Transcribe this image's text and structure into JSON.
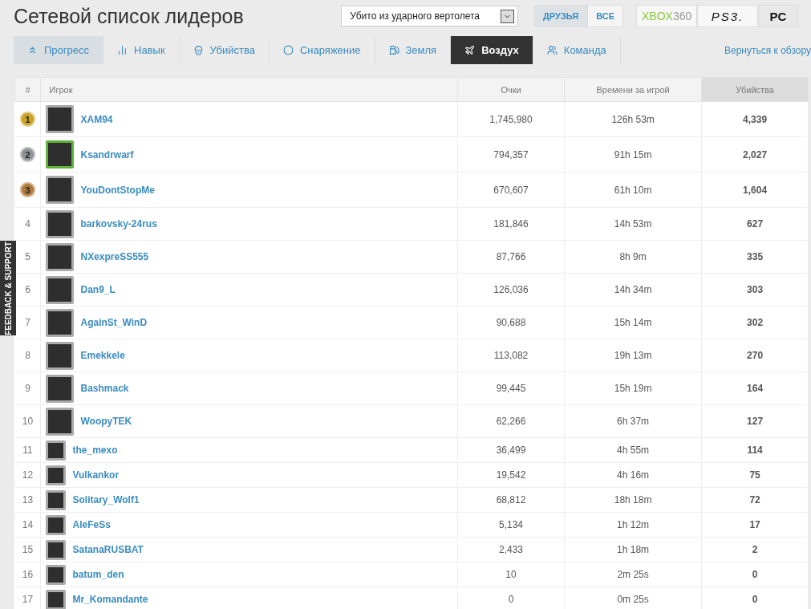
{
  "title": "Сетевой список лидеров",
  "filter_dropdown": {
    "value": "Убито из ударного вертолета"
  },
  "scope_toggle": [
    {
      "label": "ДРУЗЬЯ",
      "selected": true
    },
    {
      "label": "ВСЕ",
      "selected": false
    }
  ],
  "platforms": [
    {
      "label": "XBOX",
      "suffix": "360",
      "kind": "xbox",
      "selected": false
    },
    {
      "label": "PS3.",
      "kind": "ps",
      "selected": false
    },
    {
      "label": "PC",
      "kind": "pc",
      "selected": true
    }
  ],
  "tabs": [
    {
      "label": "Прогресс",
      "selected": false,
      "hovered": true
    },
    {
      "label": "Навык",
      "selected": false,
      "hovered": false
    },
    {
      "label": "Убийства",
      "selected": false,
      "hovered": false
    },
    {
      "label": "Снаряжение",
      "selected": false,
      "hovered": false
    },
    {
      "label": "Земля",
      "selected": false,
      "hovered": false
    },
    {
      "label": "Воздух",
      "selected": true,
      "hovered": false
    },
    {
      "label": "Команда",
      "selected": false,
      "hovered": false
    }
  ],
  "back_link": "Вернуться к обзору",
  "feedback_tab": "FEEDBACK & SUPPORT",
  "table": {
    "columns": [
      {
        "label": "#",
        "sorted": false
      },
      {
        "label": "Игрок",
        "sorted": false
      },
      {
        "label": "Очки",
        "sorted": false
      },
      {
        "label": "Времени за игрой",
        "sorted": false
      },
      {
        "label": "Убийства",
        "sorted": true
      }
    ],
    "rows": [
      {
        "rank": "1",
        "medal": true,
        "color": "#c9a227",
        "kind": "large",
        "highlighted": false,
        "player": "XAM94",
        "score": "1,745,980",
        "time": "126h 53m",
        "kills": "4,339"
      },
      {
        "rank": "2",
        "medal": true,
        "color": "#8f9398",
        "kind": "large",
        "highlighted": true,
        "player": "Ksandrwarf",
        "score": "794,357",
        "time": "91h 15m",
        "kills": "2,027"
      },
      {
        "rank": "3",
        "medal": true,
        "color": "#b07a3e",
        "kind": "large",
        "highlighted": false,
        "player": "YouDontStopMe",
        "score": "670,607",
        "time": "61h 10m",
        "kills": "1,604"
      },
      {
        "rank": "4",
        "medal": false,
        "kind": "large",
        "highlighted": false,
        "player": "barkovsky-24rus",
        "score": "181,846",
        "time": "14h 53m",
        "kills": "627"
      },
      {
        "rank": "5",
        "medal": false,
        "kind": "large",
        "highlighted": false,
        "player": "NXexpreSS555",
        "score": "87,766",
        "time": "8h 9m",
        "kills": "335"
      },
      {
        "rank": "6",
        "medal": false,
        "kind": "large",
        "highlighted": false,
        "player": "Dan9_L",
        "score": "126,036",
        "time": "14h 34m",
        "kills": "303"
      },
      {
        "rank": "7",
        "medal": false,
        "kind": "large",
        "highlighted": false,
        "player": "AgainSt_WinD",
        "score": "90,688",
        "time": "15h 14m",
        "kills": "302"
      },
      {
        "rank": "8",
        "medal": false,
        "kind": "large",
        "highlighted": false,
        "player": "Emekkele",
        "score": "113,082",
        "time": "19h 13m",
        "kills": "270"
      },
      {
        "rank": "9",
        "medal": false,
        "kind": "large",
        "highlighted": false,
        "player": "Bashmack",
        "score": "99,445",
        "time": "15h 19m",
        "kills": "164"
      },
      {
        "rank": "10",
        "medal": false,
        "kind": "large",
        "highlighted": false,
        "player": "WoopyTEK",
        "score": "62,266",
        "time": "6h 37m",
        "kills": "127"
      },
      {
        "rank": "11",
        "medal": false,
        "kind": "small",
        "highlighted": false,
        "player": "the_mexo",
        "score": "36,499",
        "time": "4h 55m",
        "kills": "114"
      },
      {
        "rank": "12",
        "medal": false,
        "kind": "small",
        "highlighted": false,
        "player": "Vulkankor",
        "score": "19,542",
        "time": "4h 16m",
        "kills": "75"
      },
      {
        "rank": "13",
        "medal": false,
        "kind": "small",
        "highlighted": false,
        "player": "Solitary_Wolf1",
        "score": "68,812",
        "time": "18h 18m",
        "kills": "72"
      },
      {
        "rank": "14",
        "medal": false,
        "kind": "small",
        "highlighted": false,
        "player": "AleFeSs",
        "score": "5,134",
        "time": "1h 12m",
        "kills": "17"
      },
      {
        "rank": "15",
        "medal": false,
        "kind": "small",
        "highlighted": false,
        "player": "SatanaRUSBAT",
        "score": "2,433",
        "time": "1h 18m",
        "kills": "2"
      },
      {
        "rank": "16",
        "medal": false,
        "kind": "small",
        "highlighted": false,
        "player": "batum_den",
        "score": "10",
        "time": "2m 25s",
        "kills": "0"
      },
      {
        "rank": "17",
        "medal": false,
        "kind": "small",
        "highlighted": false,
        "player": "Mr_Komandante",
        "score": "0",
        "time": "0m 25s",
        "kills": "0"
      }
    ]
  }
}
